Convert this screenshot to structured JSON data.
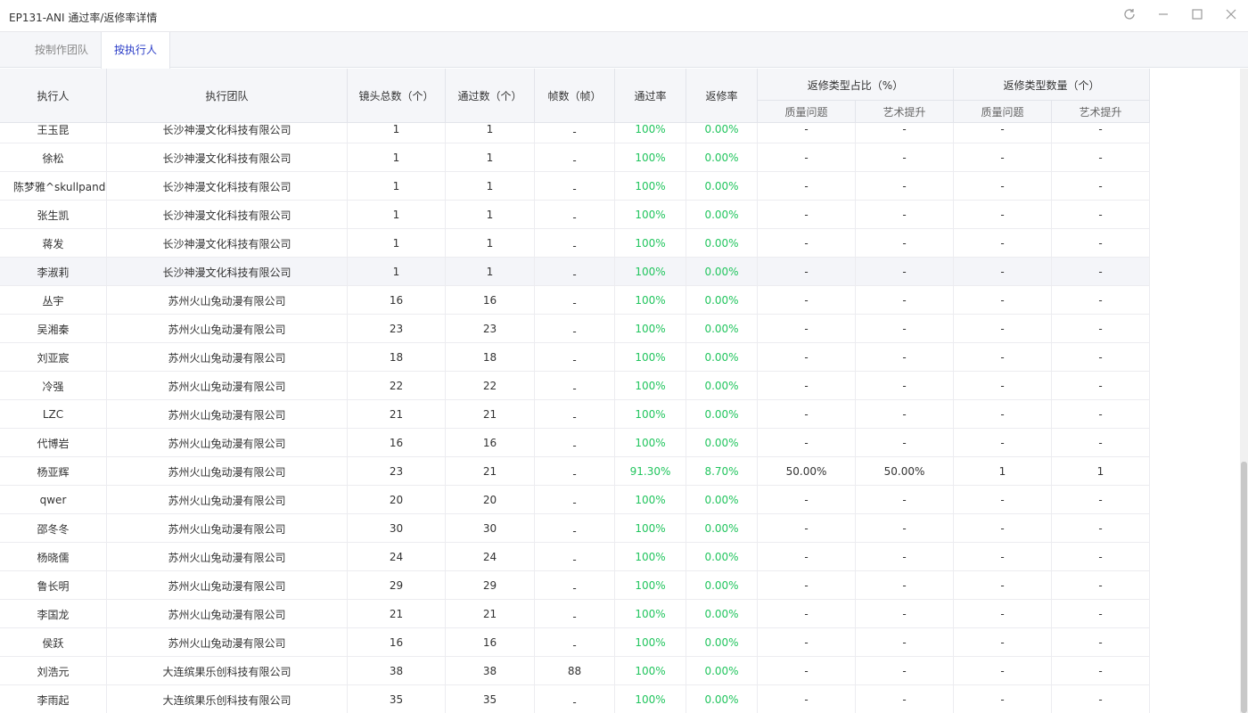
{
  "window": {
    "title": "EP131-ANI 通过率/返修率详情",
    "icons": [
      "refresh-icon",
      "minimize-icon",
      "maximize-icon",
      "close-icon"
    ]
  },
  "tabs": [
    {
      "label": "按制作团队",
      "active": false
    },
    {
      "label": "按执行人",
      "active": true
    }
  ],
  "table": {
    "headers": {
      "executor": "执行人",
      "team": "执行团队",
      "shots_total": "镜头总数（个）",
      "passed": "通过数（个）",
      "frames": "帧数（帧）",
      "pass_rate": "通过率",
      "rework_rate": "返修率",
      "rework_ratio_group": "返修类型占比（%）",
      "rework_count_group": "返修类型数量（个）",
      "quality": "质量问题",
      "art": "艺术提升"
    },
    "rows": [
      {
        "name": "王玉昆",
        "team": "长沙神漫文化科技有限公司",
        "total": "1",
        "passed": "1",
        "frames": "-",
        "pass_rate": "100%",
        "rework_rate": "0.00%",
        "q_pct": "-",
        "a_pct": "-",
        "q_cnt": "-",
        "a_cnt": "-"
      },
      {
        "name": "徐松",
        "team": "长沙神漫文化科技有限公司",
        "total": "1",
        "passed": "1",
        "frames": "-",
        "pass_rate": "100%",
        "rework_rate": "0.00%",
        "q_pct": "-",
        "a_pct": "-",
        "q_cnt": "-",
        "a_cnt": "-"
      },
      {
        "name": "陈梦雅^skullpanda",
        "team": "长沙神漫文化科技有限公司",
        "total": "1",
        "passed": "1",
        "frames": "-",
        "pass_rate": "100%",
        "rework_rate": "0.00%",
        "q_pct": "-",
        "a_pct": "-",
        "q_cnt": "-",
        "a_cnt": "-"
      },
      {
        "name": "张生凯",
        "team": "长沙神漫文化科技有限公司",
        "total": "1",
        "passed": "1",
        "frames": "-",
        "pass_rate": "100%",
        "rework_rate": "0.00%",
        "q_pct": "-",
        "a_pct": "-",
        "q_cnt": "-",
        "a_cnt": "-"
      },
      {
        "name": "蒋发",
        "team": "长沙神漫文化科技有限公司",
        "total": "1",
        "passed": "1",
        "frames": "-",
        "pass_rate": "100%",
        "rework_rate": "0.00%",
        "q_pct": "-",
        "a_pct": "-",
        "q_cnt": "-",
        "a_cnt": "-"
      },
      {
        "name": "李淑莉",
        "team": "长沙神漫文化科技有限公司",
        "total": "1",
        "passed": "1",
        "frames": "-",
        "pass_rate": "100%",
        "rework_rate": "0.00%",
        "q_pct": "-",
        "a_pct": "-",
        "q_cnt": "-",
        "a_cnt": "-",
        "highlight": true
      },
      {
        "name": "丛宇",
        "team": "苏州火山兔动漫有限公司",
        "total": "16",
        "passed": "16",
        "frames": "-",
        "pass_rate": "100%",
        "rework_rate": "0.00%",
        "q_pct": "-",
        "a_pct": "-",
        "q_cnt": "-",
        "a_cnt": "-"
      },
      {
        "name": "吴湘秦",
        "team": "苏州火山兔动漫有限公司",
        "total": "23",
        "passed": "23",
        "frames": "-",
        "pass_rate": "100%",
        "rework_rate": "0.00%",
        "q_pct": "-",
        "a_pct": "-",
        "q_cnt": "-",
        "a_cnt": "-"
      },
      {
        "name": "刘亚宸",
        "team": "苏州火山兔动漫有限公司",
        "total": "18",
        "passed": "18",
        "frames": "-",
        "pass_rate": "100%",
        "rework_rate": "0.00%",
        "q_pct": "-",
        "a_pct": "-",
        "q_cnt": "-",
        "a_cnt": "-"
      },
      {
        "name": "冷强",
        "team": "苏州火山兔动漫有限公司",
        "total": "22",
        "passed": "22",
        "frames": "-",
        "pass_rate": "100%",
        "rework_rate": "0.00%",
        "q_pct": "-",
        "a_pct": "-",
        "q_cnt": "-",
        "a_cnt": "-"
      },
      {
        "name": "LZC",
        "team": "苏州火山兔动漫有限公司",
        "total": "21",
        "passed": "21",
        "frames": "-",
        "pass_rate": "100%",
        "rework_rate": "0.00%",
        "q_pct": "-",
        "a_pct": "-",
        "q_cnt": "-",
        "a_cnt": "-"
      },
      {
        "name": "代博岩",
        "team": "苏州火山兔动漫有限公司",
        "total": "16",
        "passed": "16",
        "frames": "-",
        "pass_rate": "100%",
        "rework_rate": "0.00%",
        "q_pct": "-",
        "a_pct": "-",
        "q_cnt": "-",
        "a_cnt": "-"
      },
      {
        "name": "杨亚辉",
        "team": "苏州火山兔动漫有限公司",
        "total": "23",
        "passed": "21",
        "frames": "-",
        "pass_rate": "91.30%",
        "rework_rate": "8.70%",
        "q_pct": "50.00%",
        "a_pct": "50.00%",
        "q_cnt": "1",
        "a_cnt": "1"
      },
      {
        "name": "qwer",
        "team": "苏州火山兔动漫有限公司",
        "total": "20",
        "passed": "20",
        "frames": "-",
        "pass_rate": "100%",
        "rework_rate": "0.00%",
        "q_pct": "-",
        "a_pct": "-",
        "q_cnt": "-",
        "a_cnt": "-"
      },
      {
        "name": "邵冬冬",
        "team": "苏州火山兔动漫有限公司",
        "total": "30",
        "passed": "30",
        "frames": "-",
        "pass_rate": "100%",
        "rework_rate": "0.00%",
        "q_pct": "-",
        "a_pct": "-",
        "q_cnt": "-",
        "a_cnt": "-"
      },
      {
        "name": "杨晓儒",
        "team": "苏州火山兔动漫有限公司",
        "total": "24",
        "passed": "24",
        "frames": "-",
        "pass_rate": "100%",
        "rework_rate": "0.00%",
        "q_pct": "-",
        "a_pct": "-",
        "q_cnt": "-",
        "a_cnt": "-"
      },
      {
        "name": "鲁长明",
        "team": "苏州火山兔动漫有限公司",
        "total": "29",
        "passed": "29",
        "frames": "-",
        "pass_rate": "100%",
        "rework_rate": "0.00%",
        "q_pct": "-",
        "a_pct": "-",
        "q_cnt": "-",
        "a_cnt": "-"
      },
      {
        "name": "李国龙",
        "team": "苏州火山兔动漫有限公司",
        "total": "21",
        "passed": "21",
        "frames": "-",
        "pass_rate": "100%",
        "rework_rate": "0.00%",
        "q_pct": "-",
        "a_pct": "-",
        "q_cnt": "-",
        "a_cnt": "-"
      },
      {
        "name": "侯跃",
        "team": "苏州火山兔动漫有限公司",
        "total": "16",
        "passed": "16",
        "frames": "-",
        "pass_rate": "100%",
        "rework_rate": "0.00%",
        "q_pct": "-",
        "a_pct": "-",
        "q_cnt": "-",
        "a_cnt": "-"
      },
      {
        "name": "刘浩元",
        "team": "大连缤果乐创科技有限公司",
        "total": "38",
        "passed": "38",
        "frames": "88",
        "pass_rate": "100%",
        "rework_rate": "0.00%",
        "q_pct": "-",
        "a_pct": "-",
        "q_cnt": "-",
        "a_cnt": "-"
      },
      {
        "name": "李雨起",
        "team": "大连缤果乐创科技有限公司",
        "total": "35",
        "passed": "35",
        "frames": "-",
        "pass_rate": "100%",
        "rework_rate": "0.00%",
        "q_pct": "-",
        "a_pct": "-",
        "q_cnt": "-",
        "a_cnt": "-"
      }
    ]
  },
  "colors": {
    "accent": "#2a3cc7",
    "rate_green": "#22c55e"
  }
}
